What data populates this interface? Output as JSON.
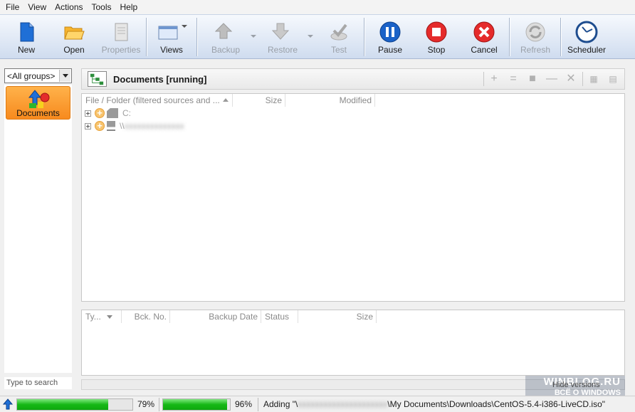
{
  "menu": [
    "File",
    "View",
    "Actions",
    "Tools",
    "Help"
  ],
  "toolbar": {
    "new": "New",
    "open": "Open",
    "properties": "Properties",
    "views": "Views",
    "backup": "Backup",
    "restore": "Restore",
    "test": "Test",
    "pause": "Pause",
    "stop": "Stop",
    "cancel": "Cancel",
    "refresh": "Refresh",
    "scheduler": "Scheduler"
  },
  "sidebar": {
    "group_select": "<All groups>",
    "job_label": "Documents",
    "search_placeholder": "Type to search"
  },
  "header": {
    "title": "Documents  [running]"
  },
  "tree": {
    "columns": [
      "File / Folder (filtered sources and ...",
      "Size",
      "Modified"
    ],
    "rows": [
      {
        "label": "C:"
      },
      {
        "label": "\\\\"
      }
    ]
  },
  "versions": {
    "columns": [
      "Ty...",
      "Bck. No.",
      "Backup Date",
      "Status",
      "Size"
    ],
    "hide_label": "Hide versions"
  },
  "watermark": {
    "line1": "WINBLOG.RU",
    "line2": "ВСЁ О WINDOWS"
  },
  "status": {
    "progress1": 79,
    "progress1_text": "79%",
    "progress2": 96,
    "progress2_text": "96%",
    "adding_prefix": "Adding \"\\",
    "adding_path": "\\My Documents\\Downloads\\CentOS-5.4-i386-LiveCD.iso\""
  },
  "colors": {
    "job_bg": "#f78a1e",
    "progress": "#16b816",
    "pause": "#1a62c8",
    "stop": "#e52b2b"
  }
}
